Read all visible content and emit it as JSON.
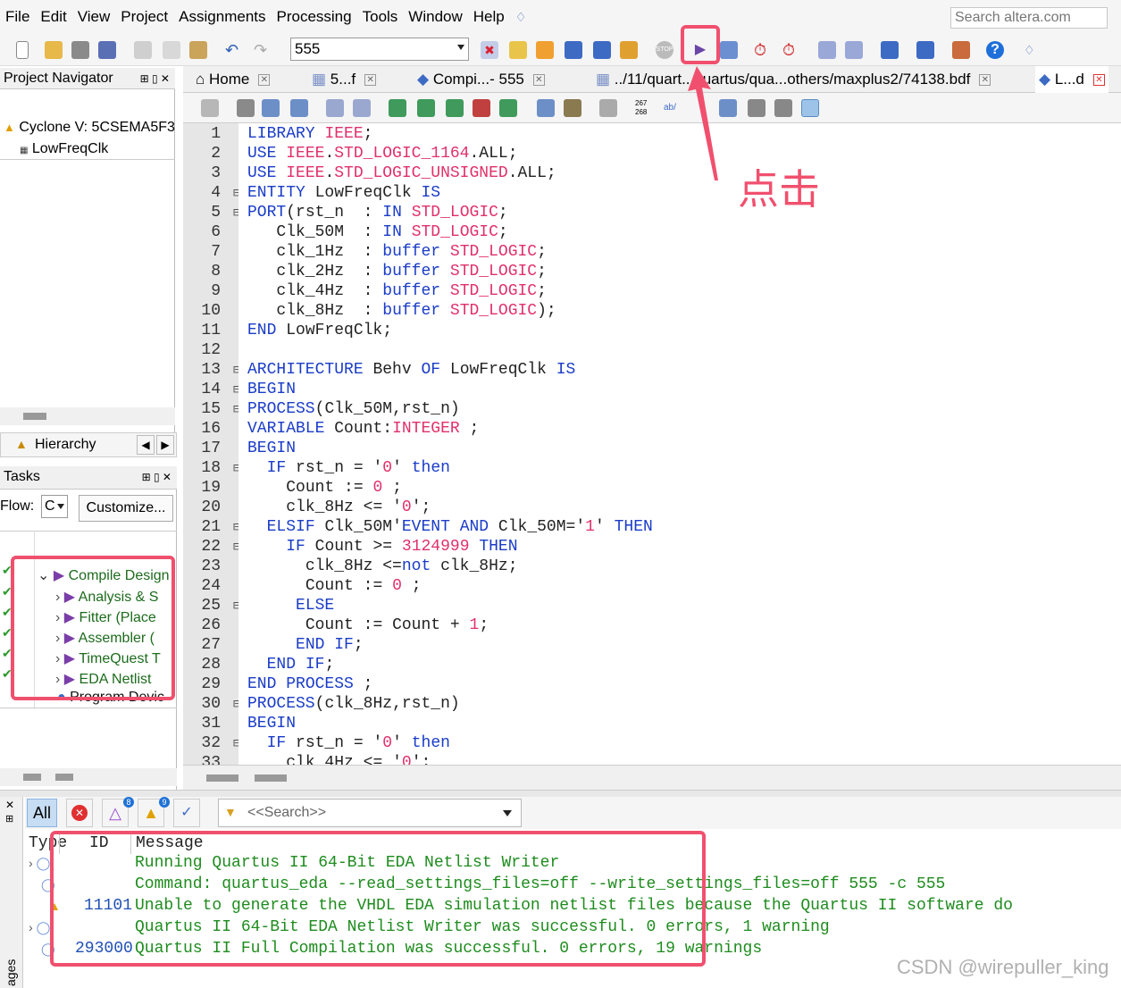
{
  "menu": [
    "File",
    "Edit",
    "View",
    "Project",
    "Assignments",
    "Processing",
    "Tools",
    "Window",
    "Help"
  ],
  "search_placeholder": "Search altera.com",
  "revision": "555",
  "project_navigator": {
    "title": "Project Navigator",
    "device": "Cyclone V: 5CSEMA5F3",
    "entity": "LowFreqClk",
    "view_dropdown": "Hierarchy"
  },
  "tasks": {
    "title": "Tasks",
    "flow_label": "Flow:",
    "flow_value": "C",
    "customize": "Customize...",
    "items": [
      "Compile Design",
      "Analysis & S",
      "Fitter (Place",
      "Assembler (",
      "TimeQuest T",
      "EDA Netlist",
      "Program Devic"
    ]
  },
  "tabs": [
    {
      "label": "Home"
    },
    {
      "label": "5...f"
    },
    {
      "label": "Compi...- 555"
    },
    {
      "label": "../11/quart...quartus/qua...others/maxplus2/74138.bdf"
    },
    {
      "label": "L...d"
    }
  ],
  "annotation": "点击",
  "code_lines": [
    "LIBRARY IEEE;",
    "USE IEEE.STD_LOGIC_1164.ALL;",
    "USE IEEE.STD_LOGIC_UNSIGNED.ALL;",
    "ENTITY LowFreqClk IS",
    "PORT(rst_n  : IN STD_LOGIC;",
    "   Clk_50M  : IN STD_LOGIC;",
    "   clk_1Hz  : buffer STD_LOGIC;",
    "   clk_2Hz  : buffer STD_LOGIC;",
    "   clk_4Hz  : buffer STD_LOGIC;",
    "   clk_8Hz  : buffer STD_LOGIC);",
    "END LowFreqClk;",
    "",
    "ARCHITECTURE Behv OF LowFreqClk IS",
    "BEGIN",
    "PROCESS(Clk_50M,rst_n)",
    "VARIABLE Count:INTEGER ;",
    "BEGIN",
    "  IF rst_n = '0' then",
    "    Count := 0 ;",
    "    clk_8Hz <= '0';",
    "  ELSIF Clk_50M'EVENT AND Clk_50M='1' THEN",
    "    IF Count >= 3124999 THEN",
    "      clk_8Hz <=not clk_8Hz;",
    "      Count := 0 ;",
    "     ELSE",
    "      Count := Count + 1;",
    "     END IF;",
    "  END IF;",
    "END PROCESS ;",
    "PROCESS(clk_8Hz,rst_n)",
    "BEGIN",
    "  IF rst_n = '0' then",
    "    clk_4Hz <= '0';"
  ],
  "messages": {
    "filter_all": "All",
    "badge_count_1": "8",
    "badge_count_2": "9",
    "search_placeholder": "<<Search>>",
    "columns": [
      "Type",
      "ID",
      "Message"
    ],
    "rows": [
      {
        "id": "",
        "text": "Running Quartus II 64-Bit EDA Netlist Writer"
      },
      {
        "id": "",
        "text": "Command: quartus_eda --read_settings_files=off --write_settings_files=off 555 -c 555"
      },
      {
        "id": "11101",
        "text": "Unable to generate the VHDL EDA simulation netlist files because the Quartus II software do"
      },
      {
        "id": "",
        "text": "Quartus II 64-Bit EDA Netlist Writer was successful. 0 errors, 1 warning"
      },
      {
        "id": "293000",
        "text": "Quartus II Full Compilation was successful. 0 errors, 19 warnings"
      }
    ],
    "side_label": "ages"
  },
  "watermark": "CSDN @wirepuller_king",
  "colors": {
    "highlight": "#f0506e",
    "keyword": "#1a3cc8",
    "type": "#e0306a",
    "message": "#1e8c1e"
  }
}
